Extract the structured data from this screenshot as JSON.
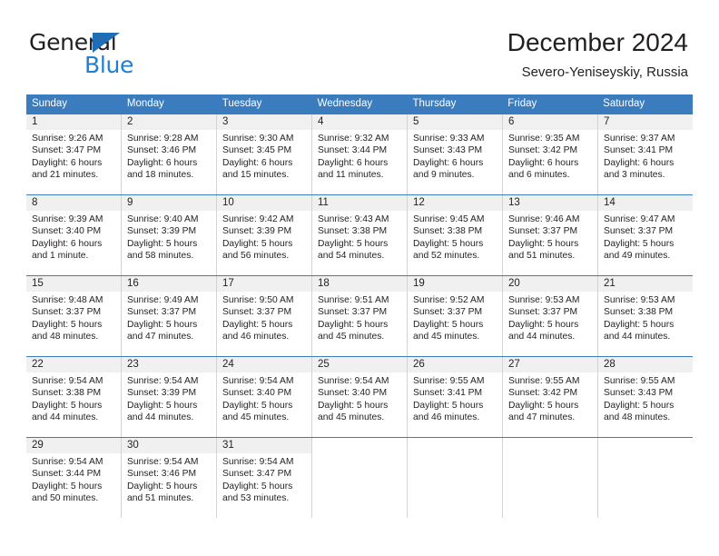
{
  "branding": {
    "logo_text_top": "General",
    "logo_text_bottom": "Blue",
    "logo_triangle_color": "#1f6eb5",
    "logo_blue_color": "#1f7fd0"
  },
  "header": {
    "title": "December 2024",
    "subtitle": "Severo-Yeniseyskiy, Russia"
  },
  "theme": {
    "header_row_bg": "#3a7cbe",
    "header_row_text": "#ffffff",
    "daynum_band_bg": "#f0f0f0",
    "cell_divider": "#d3d3d3",
    "week_divider": "#3a7cbe",
    "text": "#231f20"
  },
  "calendar": {
    "weekdays": [
      "Sunday",
      "Monday",
      "Tuesday",
      "Wednesday",
      "Thursday",
      "Friday",
      "Saturday"
    ],
    "weeks": [
      [
        {
          "day": "1",
          "sunrise": "Sunrise: 9:26 AM",
          "sunset": "Sunset: 3:47 PM",
          "daylight_1": "Daylight: 6 hours",
          "daylight_2": "and 21 minutes."
        },
        {
          "day": "2",
          "sunrise": "Sunrise: 9:28 AM",
          "sunset": "Sunset: 3:46 PM",
          "daylight_1": "Daylight: 6 hours",
          "daylight_2": "and 18 minutes."
        },
        {
          "day": "3",
          "sunrise": "Sunrise: 9:30 AM",
          "sunset": "Sunset: 3:45 PM",
          "daylight_1": "Daylight: 6 hours",
          "daylight_2": "and 15 minutes."
        },
        {
          "day": "4",
          "sunrise": "Sunrise: 9:32 AM",
          "sunset": "Sunset: 3:44 PM",
          "daylight_1": "Daylight: 6 hours",
          "daylight_2": "and 11 minutes."
        },
        {
          "day": "5",
          "sunrise": "Sunrise: 9:33 AM",
          "sunset": "Sunset: 3:43 PM",
          "daylight_1": "Daylight: 6 hours",
          "daylight_2": "and 9 minutes."
        },
        {
          "day": "6",
          "sunrise": "Sunrise: 9:35 AM",
          "sunset": "Sunset: 3:42 PM",
          "daylight_1": "Daylight: 6 hours",
          "daylight_2": "and 6 minutes."
        },
        {
          "day": "7",
          "sunrise": "Sunrise: 9:37 AM",
          "sunset": "Sunset: 3:41 PM",
          "daylight_1": "Daylight: 6 hours",
          "daylight_2": "and 3 minutes."
        }
      ],
      [
        {
          "day": "8",
          "sunrise": "Sunrise: 9:39 AM",
          "sunset": "Sunset: 3:40 PM",
          "daylight_1": "Daylight: 6 hours",
          "daylight_2": "and 1 minute."
        },
        {
          "day": "9",
          "sunrise": "Sunrise: 9:40 AM",
          "sunset": "Sunset: 3:39 PM",
          "daylight_1": "Daylight: 5 hours",
          "daylight_2": "and 58 minutes."
        },
        {
          "day": "10",
          "sunrise": "Sunrise: 9:42 AM",
          "sunset": "Sunset: 3:39 PM",
          "daylight_1": "Daylight: 5 hours",
          "daylight_2": "and 56 minutes."
        },
        {
          "day": "11",
          "sunrise": "Sunrise: 9:43 AM",
          "sunset": "Sunset: 3:38 PM",
          "daylight_1": "Daylight: 5 hours",
          "daylight_2": "and 54 minutes."
        },
        {
          "day": "12",
          "sunrise": "Sunrise: 9:45 AM",
          "sunset": "Sunset: 3:38 PM",
          "daylight_1": "Daylight: 5 hours",
          "daylight_2": "and 52 minutes."
        },
        {
          "day": "13",
          "sunrise": "Sunrise: 9:46 AM",
          "sunset": "Sunset: 3:37 PM",
          "daylight_1": "Daylight: 5 hours",
          "daylight_2": "and 51 minutes."
        },
        {
          "day": "14",
          "sunrise": "Sunrise: 9:47 AM",
          "sunset": "Sunset: 3:37 PM",
          "daylight_1": "Daylight: 5 hours",
          "daylight_2": "and 49 minutes."
        }
      ],
      [
        {
          "day": "15",
          "sunrise": "Sunrise: 9:48 AM",
          "sunset": "Sunset: 3:37 PM",
          "daylight_1": "Daylight: 5 hours",
          "daylight_2": "and 48 minutes."
        },
        {
          "day": "16",
          "sunrise": "Sunrise: 9:49 AM",
          "sunset": "Sunset: 3:37 PM",
          "daylight_1": "Daylight: 5 hours",
          "daylight_2": "and 47 minutes."
        },
        {
          "day": "17",
          "sunrise": "Sunrise: 9:50 AM",
          "sunset": "Sunset: 3:37 PM",
          "daylight_1": "Daylight: 5 hours",
          "daylight_2": "and 46 minutes."
        },
        {
          "day": "18",
          "sunrise": "Sunrise: 9:51 AM",
          "sunset": "Sunset: 3:37 PM",
          "daylight_1": "Daylight: 5 hours",
          "daylight_2": "and 45 minutes."
        },
        {
          "day": "19",
          "sunrise": "Sunrise: 9:52 AM",
          "sunset": "Sunset: 3:37 PM",
          "daylight_1": "Daylight: 5 hours",
          "daylight_2": "and 45 minutes."
        },
        {
          "day": "20",
          "sunrise": "Sunrise: 9:53 AM",
          "sunset": "Sunset: 3:37 PM",
          "daylight_1": "Daylight: 5 hours",
          "daylight_2": "and 44 minutes."
        },
        {
          "day": "21",
          "sunrise": "Sunrise: 9:53 AM",
          "sunset": "Sunset: 3:38 PM",
          "daylight_1": "Daylight: 5 hours",
          "daylight_2": "and 44 minutes."
        }
      ],
      [
        {
          "day": "22",
          "sunrise": "Sunrise: 9:54 AM",
          "sunset": "Sunset: 3:38 PM",
          "daylight_1": "Daylight: 5 hours",
          "daylight_2": "and 44 minutes."
        },
        {
          "day": "23",
          "sunrise": "Sunrise: 9:54 AM",
          "sunset": "Sunset: 3:39 PM",
          "daylight_1": "Daylight: 5 hours",
          "daylight_2": "and 44 minutes."
        },
        {
          "day": "24",
          "sunrise": "Sunrise: 9:54 AM",
          "sunset": "Sunset: 3:40 PM",
          "daylight_1": "Daylight: 5 hours",
          "daylight_2": "and 45 minutes."
        },
        {
          "day": "25",
          "sunrise": "Sunrise: 9:54 AM",
          "sunset": "Sunset: 3:40 PM",
          "daylight_1": "Daylight: 5 hours",
          "daylight_2": "and 45 minutes."
        },
        {
          "day": "26",
          "sunrise": "Sunrise: 9:55 AM",
          "sunset": "Sunset: 3:41 PM",
          "daylight_1": "Daylight: 5 hours",
          "daylight_2": "and 46 minutes."
        },
        {
          "day": "27",
          "sunrise": "Sunrise: 9:55 AM",
          "sunset": "Sunset: 3:42 PM",
          "daylight_1": "Daylight: 5 hours",
          "daylight_2": "and 47 minutes."
        },
        {
          "day": "28",
          "sunrise": "Sunrise: 9:55 AM",
          "sunset": "Sunset: 3:43 PM",
          "daylight_1": "Daylight: 5 hours",
          "daylight_2": "and 48 minutes."
        }
      ],
      [
        {
          "day": "29",
          "sunrise": "Sunrise: 9:54 AM",
          "sunset": "Sunset: 3:44 PM",
          "daylight_1": "Daylight: 5 hours",
          "daylight_2": "and 50 minutes."
        },
        {
          "day": "30",
          "sunrise": "Sunrise: 9:54 AM",
          "sunset": "Sunset: 3:46 PM",
          "daylight_1": "Daylight: 5 hours",
          "daylight_2": "and 51 minutes."
        },
        {
          "day": "31",
          "sunrise": "Sunrise: 9:54 AM",
          "sunset": "Sunset: 3:47 PM",
          "daylight_1": "Daylight: 5 hours",
          "daylight_2": "and 53 minutes."
        },
        {
          "day": "",
          "sunrise": "",
          "sunset": "",
          "daylight_1": "",
          "daylight_2": ""
        },
        {
          "day": "",
          "sunrise": "",
          "sunset": "",
          "daylight_1": "",
          "daylight_2": ""
        },
        {
          "day": "",
          "sunrise": "",
          "sunset": "",
          "daylight_1": "",
          "daylight_2": ""
        },
        {
          "day": "",
          "sunrise": "",
          "sunset": "",
          "daylight_1": "",
          "daylight_2": ""
        }
      ]
    ]
  }
}
